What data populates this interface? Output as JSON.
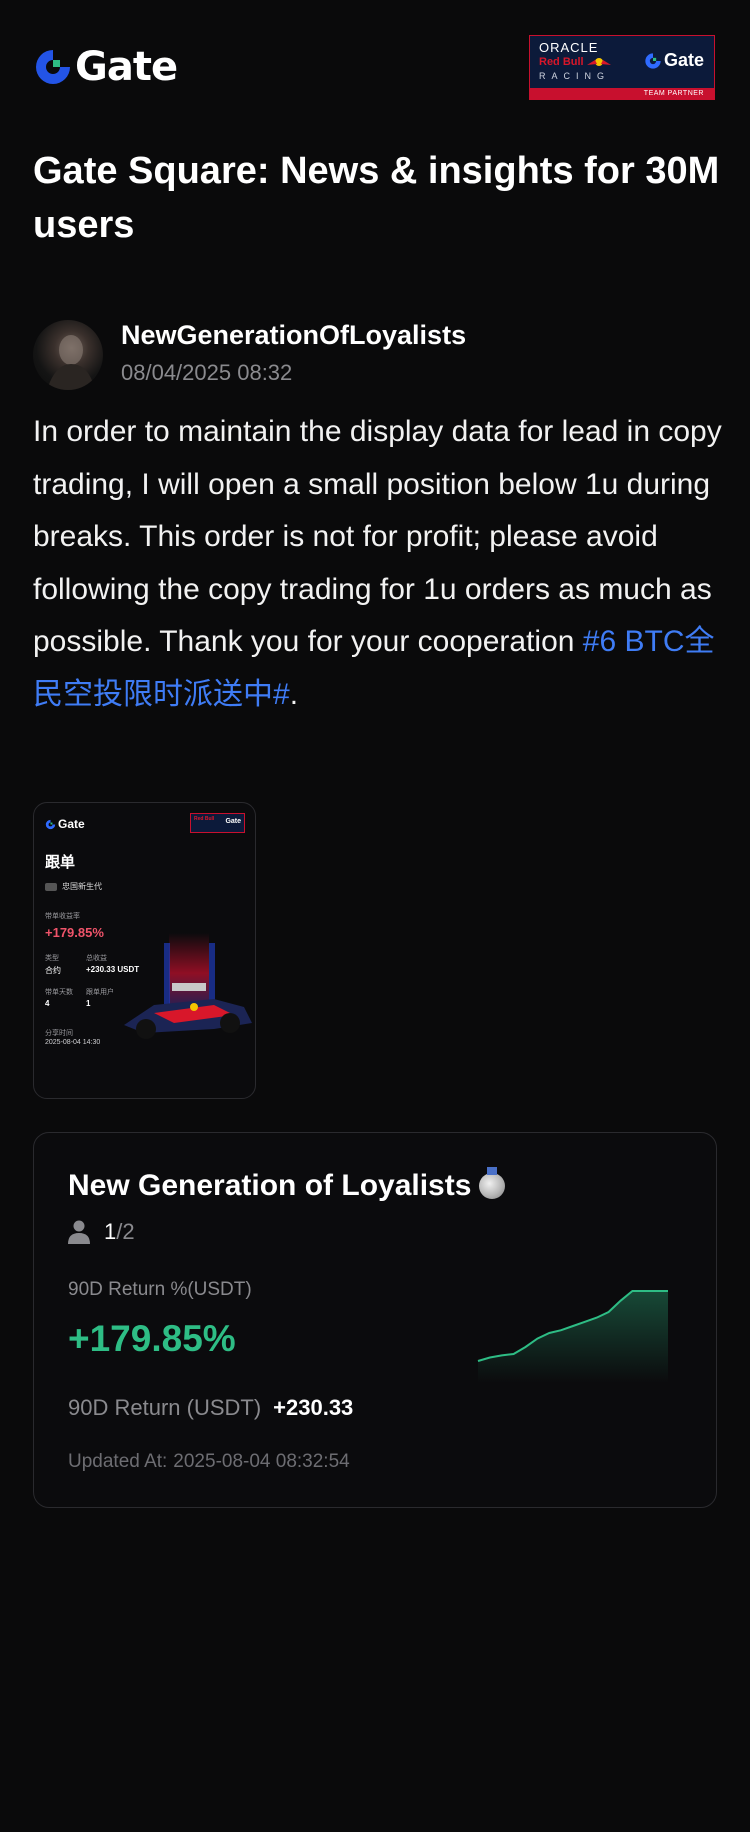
{
  "header": {
    "logo_text": "Gate",
    "partner": {
      "oracle": "ORACLE",
      "red_bull": "Red Bull",
      "racing": "RACING",
      "brand": "Gate",
      "footer": "TEAM PARTNER"
    }
  },
  "page_title": "Gate Square: News & insights for 30M users",
  "post": {
    "author_name": "NewGenerationOfLoyalists",
    "timestamp": "08/04/2025 08:32",
    "body": "In order to maintain the display data for lead in copy trading, I will open a small position below 1u during breaks. This order is not for profit; please avoid following the copy trading for 1u orders as much as possible. Thank you for your cooperation ",
    "hashtag": "#6 BTC全民空投限时派送中#",
    "body_end": "."
  },
  "share_image": {
    "logo_text": "Gate",
    "title": "跟单",
    "user": "忠国新生代",
    "return_label": "带单收益率",
    "return_value": "+179.85%",
    "type_label": "类型",
    "type_value": "合约",
    "pnl_label": "总收益",
    "pnl_value": "+230.33 USDT",
    "days_label": "带单天数",
    "days_value": "4",
    "followers_label": "跟单用户",
    "followers_value": "1",
    "share_time_label": "分享时间",
    "share_time_value": "2025-08-04 14:30"
  },
  "trader_card": {
    "name": "New Generation of Loyalists",
    "medal_icon": "silver-medal-icon",
    "followers_current": "1",
    "followers_separator": "/",
    "followers_max": "2",
    "return_pct_label": "90D Return %(USDT)",
    "return_pct_value": "+179.85%",
    "return_abs_label": "90D Return (USDT)",
    "return_abs_value": "+230.33",
    "updated_label": "Updated At:",
    "updated_value": "2025-08-04 08:32:54"
  },
  "colors": {
    "background": "#0a0a0b",
    "accent_blue": "#3f7cf5",
    "positive_green": "#2ebd85",
    "muted": "#8a8a8e",
    "share_red": "#f0546a"
  },
  "sparkline": {
    "values": [
      0,
      0.05,
      0.08,
      0.1,
      0.2,
      0.32,
      0.4,
      0.44,
      0.5,
      0.56,
      0.62,
      0.7,
      0.86,
      1,
      1,
      1,
      1
    ]
  }
}
